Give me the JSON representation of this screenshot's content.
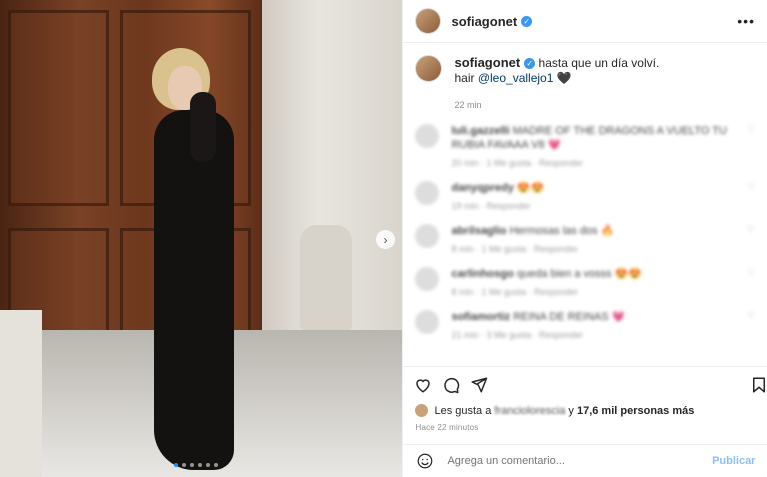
{
  "post": {
    "username": "sofiagonet",
    "caption_text": "hasta que un día volví.",
    "caption_line2_prefix": "hair",
    "caption_mention": "@leo_vallejo1",
    "caption_emoji": "🖤",
    "caption_time": "22 min",
    "slides_total": 6,
    "slide_current": 1
  },
  "comments": [
    {
      "user": "luli.gazzelli",
      "text": "MADRE OF THE DRAGONS A VUELTO TU RUBIA FAVAAA V8 💗",
      "meta": "20 min · 1 Me gusta · Responder"
    },
    {
      "user": "danyqpredy",
      "text": "😍😍",
      "meta": "19 min · Responder"
    },
    {
      "user": "abrilsaglio",
      "text": "Hermosas las dos 🔥",
      "meta": "8 min · 1 Me gusta · Responder"
    },
    {
      "user": "carlinhosgo",
      "text": "queda bien a vosss 😍😍",
      "meta": "8 min · 1 Me gusta · Responder"
    },
    {
      "user": "sofiamortiz",
      "text": "REINA DE REINAS 💗",
      "meta": "21 min · 3 Me gusta · Responder"
    }
  ],
  "likes": {
    "prefix": "Les gusta a",
    "user": "franciolorescia",
    "middle": "y",
    "count": "17,6 mil personas más"
  },
  "posted_ago": "Hace 22 minutos",
  "add_comment": {
    "placeholder": "Agrega un comentario...",
    "publish_label": "Publicar"
  },
  "icons": {
    "more": "more-dots-icon",
    "verified": "verified-badge-icon",
    "like": "heart-icon",
    "comment": "comment-bubble-icon",
    "share": "paper-plane-icon",
    "save": "bookmark-icon",
    "emoji": "smiley-icon",
    "next": "chevron-right-icon"
  },
  "colors": {
    "verified_blue": "#3897f0",
    "mention_blue": "#00376b",
    "publish_disabled": "#8ec0f5",
    "active_dot": "#1a8cff"
  }
}
